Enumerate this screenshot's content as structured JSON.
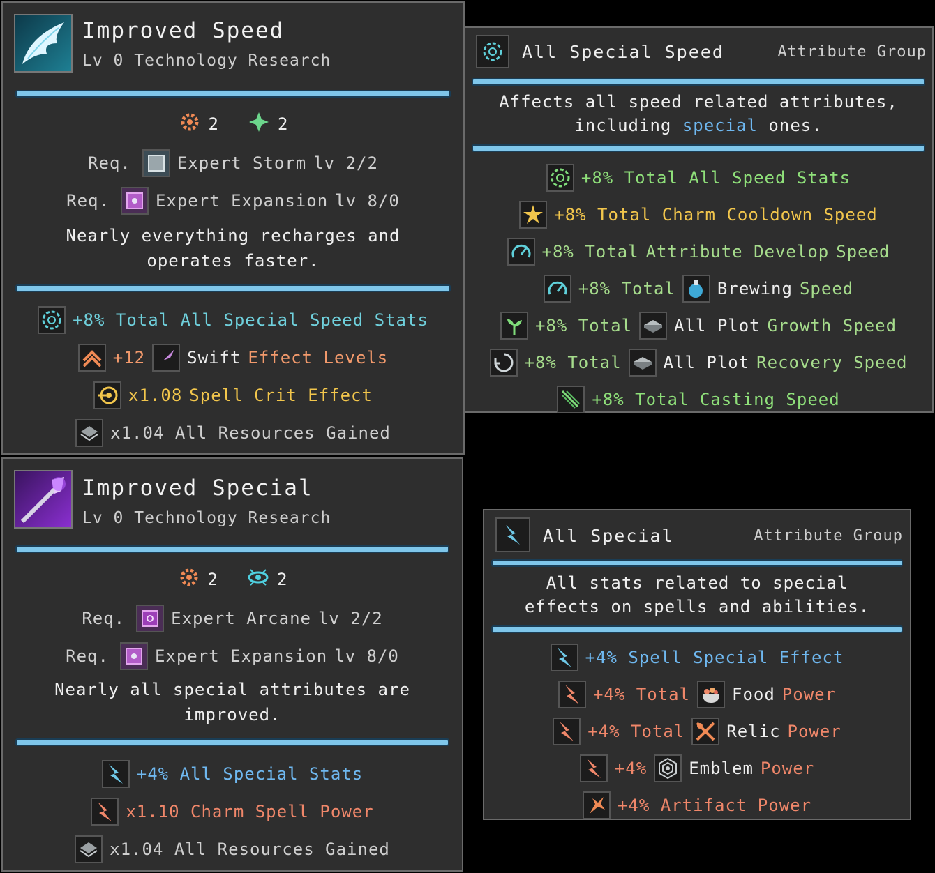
{
  "speed": {
    "title": "Improved Speed",
    "subtitle": "Lv 0 Technology Research",
    "cost1": "2",
    "cost2": "2",
    "req_label": "Req.",
    "req1": {
      "name": "Expert Storm",
      "lv": "lv 2/2"
    },
    "req2": {
      "name": "Expert Expansion",
      "lv": "lv 8/0"
    },
    "desc1": "Nearly everything recharges and",
    "desc2": "operates faster.",
    "effects": {
      "e1": "+8% Total All Special Speed Stats",
      "e2a": "+12",
      "e2b": "Swift",
      "e2c": "Effect Levels",
      "e3a": "x1.08",
      "e3b": "Spell Crit Effect",
      "e4": "x1.04 All Resources Gained"
    }
  },
  "special": {
    "title": "Improved Special",
    "subtitle": "Lv 0 Technology Research",
    "cost1": "2",
    "cost2": "2",
    "req_label": "Req.",
    "req1": {
      "name": "Expert Arcane",
      "lv": "lv 2/2"
    },
    "req2": {
      "name": "Expert Expansion",
      "lv": "lv 8/0"
    },
    "desc1": "Nearly all special attributes are",
    "desc2": "improved.",
    "effects": {
      "e1": "+4% All Special Stats",
      "e2": "x1.10 Charm Spell Power",
      "e3": "x1.04 All Resources Gained"
    }
  },
  "group_speed": {
    "title": "All Special Speed",
    "tag": "Attribute Group",
    "desc1": "Affects all speed related attributes,",
    "desc2a": "including",
    "desc2b": "special",
    "desc2c": "ones.",
    "rows": {
      "r1": "+8% Total All Speed Stats",
      "r2": "+8% Total Charm Cooldown Speed",
      "r3a": "+8% Total",
      "r3b": "Attribute Develop",
      "r3c": "Speed",
      "r4a": "+8% Total",
      "r4b": "Brewing",
      "r4c": "Speed",
      "r5a": "+8% Total",
      "r5b": "All Plot",
      "r5c": "Growth Speed",
      "r6a": "+8% Total",
      "r6b": "All Plot",
      "r6c": "Recovery Speed",
      "r7": "+8% Total Casting Speed"
    }
  },
  "group_special": {
    "title": "All Special",
    "tag": "Attribute Group",
    "desc1": "All stats related to special",
    "desc2": "effects on spells and abilities.",
    "rows": {
      "r1": "+4% Spell Special Effect",
      "r2a": "+4% Total",
      "r2b": "Food",
      "r2c": "Power",
      "r3a": "+4% Total",
      "r3b": "Relic",
      "r3c": "Power",
      "r4a": "+4%",
      "r4b": "Emblem",
      "r4c": "Power",
      "r5": "+4% Artifact Power"
    }
  },
  "colors": {
    "panel": "#2e2e2e",
    "bar": "#7fc6ea",
    "cyan": "#6fd0dc",
    "green": "#8fe07a",
    "orange": "#f39a6c",
    "gold": "#f2c64c",
    "blue": "#6fb8f0",
    "salmon": "#f0876a"
  },
  "icons": [
    "wing-portrait",
    "spear-portrait",
    "gear-cost-icon",
    "leaf-cost-icon",
    "eye-cost-icon",
    "book-icon",
    "spellbook-icon",
    "speed-gear-icon",
    "chevron-up-icon",
    "swift-icon",
    "crit-target-icon",
    "resources-icon",
    "lightning-icon",
    "charm-lightning-icon",
    "charm-star-icon",
    "gauge-icon",
    "potion-icon",
    "sprout-icon",
    "plot-icon",
    "recycle-icon",
    "casting-icon",
    "food-icon",
    "relic-icon",
    "emblem-icon",
    "artifact-icon"
  ]
}
